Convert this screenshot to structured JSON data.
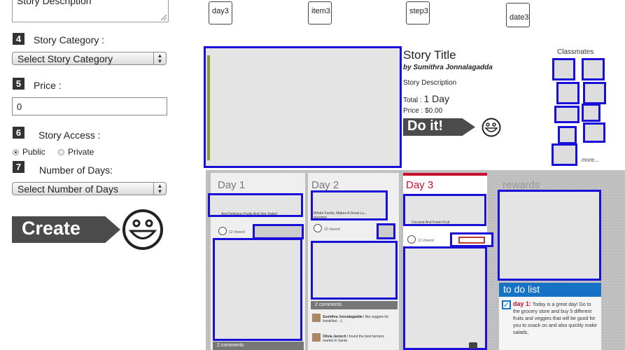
{
  "form": {
    "description_placeholder": "Story Description",
    "steps": [
      {
        "num": "4",
        "label": "Story Category :"
      },
      {
        "num": "5",
        "label": "Price :"
      },
      {
        "num": "6",
        "label": "Story Access :"
      },
      {
        "num": "7",
        "label": "Number of Days:"
      }
    ],
    "category_select": "Select Story Category",
    "price_value": "0",
    "access_options": [
      {
        "label": "Public",
        "selected": true
      },
      {
        "label": "Private",
        "selected": false
      }
    ],
    "days_select": "Select Number of Days",
    "create_label": "Create"
  },
  "cards": [
    "day3",
    "item3",
    "step3",
    "date3"
  ],
  "preview": {
    "title": "Story Title",
    "author": "by Sumithra Jonnalagadda",
    "description": "Story Description",
    "total_label": "Total :",
    "total_value": "1 Day",
    "price": "Price : $0.00",
    "doit_label": "Do it!",
    "classmates_label": "Classmates",
    "more_label": "more..."
  },
  "board": {
    "days": [
      "Day 1",
      "Day 2",
      "Day 3"
    ],
    "rewards_label": "rewards",
    "day1_snippet": "And Delicious Fruits And Veg Today!",
    "day2_snippet": "Whole Foods, Makes A Great Lu... pucomo!",
    "day3_snippet": "Coconut And Fresh Fruit",
    "cheers": [
      "12 cheers!",
      "12 cheers!",
      "12 cheers!"
    ],
    "comments_label": "2 comments",
    "comments": [
      {
        "author": "Sumithra Jonnalagadda",
        "text": "I like veggies for breakfast. ;-)"
      },
      {
        "author": "Olivia Janisch",
        "text": "I found the best farmers market in Santa"
      }
    ],
    "todo_title": "to do list",
    "todo_day": "day 1:",
    "todo_text": "Today is a great day! Go to the grocery store and buy 5 different fruits and veggies that will be good for you to snack on and also quickly make salads,"
  }
}
